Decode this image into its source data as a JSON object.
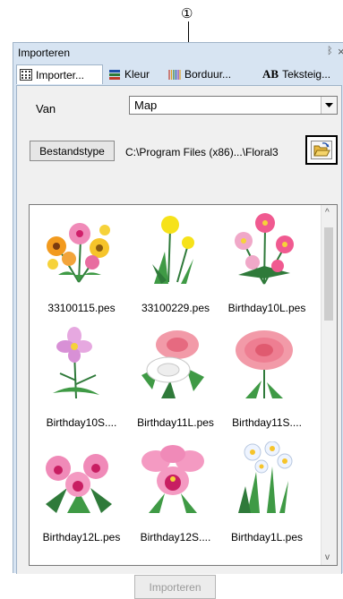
{
  "callout": "①",
  "window": {
    "title": "Importeren",
    "pin_glyph": "ᛒ",
    "close_glyph": "×"
  },
  "tabs": [
    {
      "label": "Importer...",
      "icon": "grid-icon",
      "active": true
    },
    {
      "label": "Kleur",
      "icon": "thread-spools-icon",
      "active": false
    },
    {
      "label": "Borduur...",
      "icon": "embroidery-pattern-icon",
      "active": false
    },
    {
      "label": "Teksteig...",
      "icon": "text-ab-icon",
      "prefix": "AB",
      "active": false
    }
  ],
  "form": {
    "from_label": "Van",
    "from_value": "Map",
    "file_type_button": "Bestandstype",
    "path": "C:\\Program Files (x86)...\\Floral3"
  },
  "files": [
    {
      "name": "33100115.pes"
    },
    {
      "name": "33100229.pes"
    },
    {
      "name": "Birthday10L.pes"
    },
    {
      "name": "Birthday10S...."
    },
    {
      "name": "Birthday11L.pes"
    },
    {
      "name": "Birthday11S...."
    },
    {
      "name": "Birthday12L.pes"
    },
    {
      "name": "Birthday12S...."
    },
    {
      "name": "Birthday1L.pes"
    }
  ],
  "scroll": {
    "up_glyph": "^",
    "down_glyph": "v"
  },
  "import_button": "Importeren",
  "colors": {
    "panel": "#d7e4f2",
    "content": "#f0f0f0",
    "disabled_text": "#9a9a9a"
  }
}
